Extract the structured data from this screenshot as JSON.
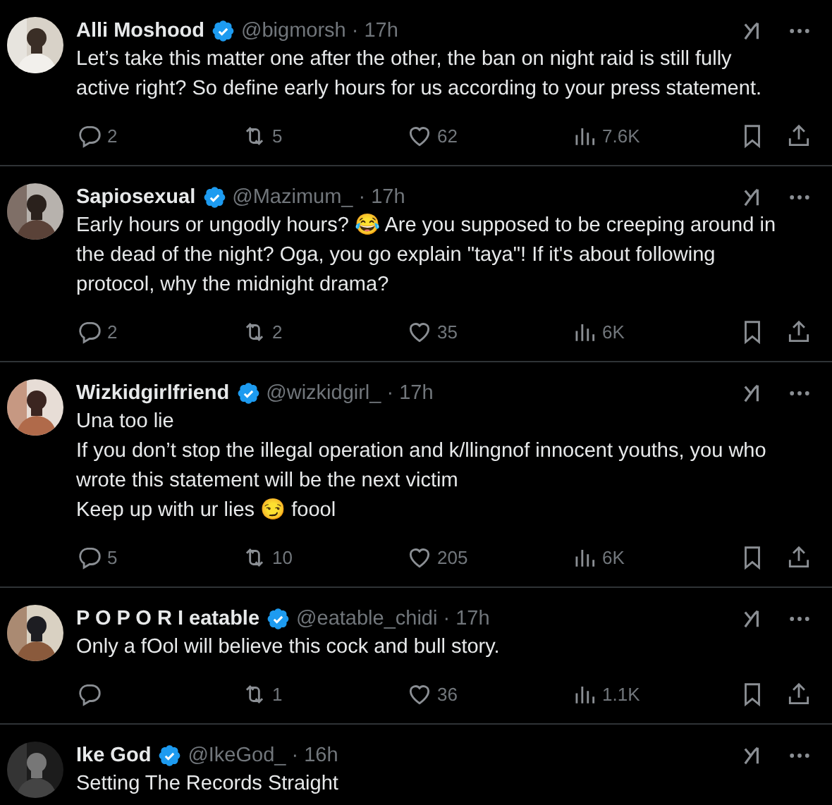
{
  "tweets": [
    {
      "name": "Alli Moshood",
      "verified": true,
      "handle": "@bigmorsh",
      "time": "· 17h",
      "body": [
        "Let’s take this matter one after the other, the ban on night raid is still fully active right? So define early hours for us according to your press statement."
      ],
      "actions": {
        "replies": "2",
        "reposts": "5",
        "likes": "62",
        "views": "7.6K"
      }
    },
    {
      "name": "Sapiosexual",
      "verified": true,
      "handle": "@Mazimum_",
      "time": "· 17h",
      "body": [
        "Early hours or ungodly hours? 😂 Are you supposed to be creeping around in the dead of the night? Oga, you go explain \"taya\"! If it's about following protocol, why the midnight drama?"
      ],
      "actions": {
        "replies": "2",
        "reposts": "2",
        "likes": "35",
        "views": "6K"
      }
    },
    {
      "name": "Wizkidgirlfriend",
      "verified": true,
      "handle": "@wizkidgirl_",
      "time": "· 17h",
      "body": [
        "Una too lie",
        "If you don’t stop the illegal operation and k/llingnof innocent youths, you who wrote this statement will be the next victim",
        "Keep up with ur lies 😏 foool"
      ],
      "actions": {
        "replies": "5",
        "reposts": "10",
        "likes": "205",
        "views": "6K"
      }
    },
    {
      "name": "P O P O R I eatable",
      "verified": true,
      "handle": "@eatable_chidi",
      "time": "· 17h",
      "body": [
        "Only a fOol will believe this cock and bull story."
      ],
      "actions": {
        "reposts": "1",
        "likes": "36",
        "views": "1.1K"
      }
    },
    {
      "name": "Ike God",
      "verified": true,
      "handle": "@IkeGod_",
      "time": "· 16h",
      "body": [
        "Setting The Records Straight"
      ]
    }
  ]
}
